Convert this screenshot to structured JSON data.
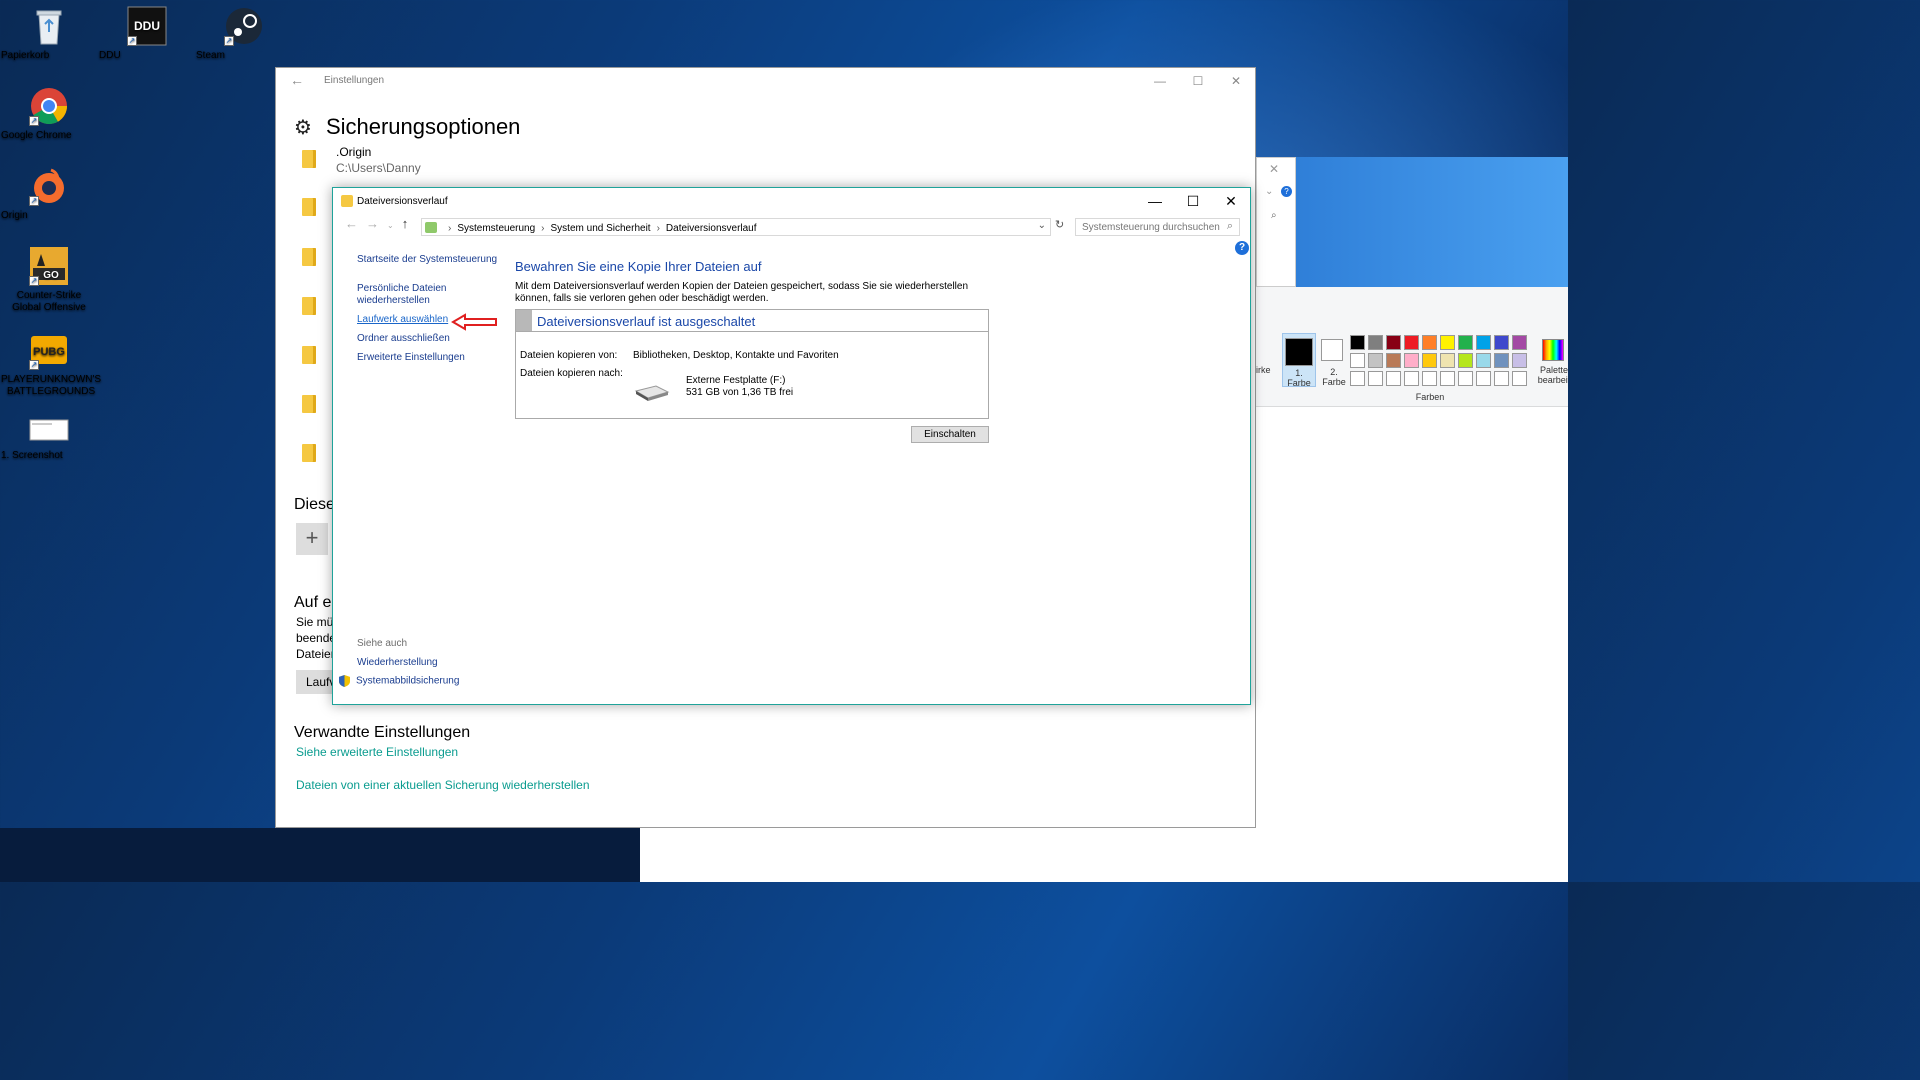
{
  "desktop": {
    "icons": [
      {
        "label": "Papierkorb",
        "icon": "recycle-bin-icon"
      },
      {
        "label": "DDU",
        "icon": "ddu-icon"
      },
      {
        "label": "Steam",
        "icon": "steam-icon"
      },
      {
        "label": "Google Chrome",
        "icon": "chrome-icon"
      },
      {
        "label": "Origin",
        "icon": "origin-icon"
      },
      {
        "label": "Counter-Strike Global Offensive",
        "icon": "csgo-icon"
      },
      {
        "label": "PLAYERUNKNOWN'S BATTLEGROUNDS",
        "icon": "pubg-icon"
      },
      {
        "label": "1. Screenshot",
        "icon": "screenshot-icon"
      }
    ]
  },
  "settings": {
    "window_title": "Einstellungen",
    "page_title": "Sicherungsoptionen",
    "folder_item": {
      "name": ".Origin",
      "path": "C:\\Users\\Danny"
    },
    "section_partial": "Diese",
    "section2_partial": "Auf e",
    "section2_lines": [
      "Sie mü",
      "beende",
      "Dateier"
    ],
    "button_partial": "Laufv",
    "related_title": "Verwandte Einstellungen",
    "link_advanced": "Siehe erweiterte Einstellungen",
    "link_restore": "Dateien von einer aktuellen Sicherung wiederherstellen"
  },
  "paint": {
    "color1_label": "1. Farbe",
    "color2_label": "2. Farbe",
    "strength_partial": "irke",
    "palette_edit": "Palette bearbeit",
    "colors_group": "Farben",
    "swatches_row1": [
      "#000000",
      "#7f7f7f",
      "#880015",
      "#ed1c24",
      "#ff7f27",
      "#fff200",
      "#22b14c",
      "#00a2e8",
      "#3f48cc",
      "#a349a4"
    ],
    "swatches_row2": [
      "#ffffff",
      "#c3c3c3",
      "#b97a57",
      "#ffaec9",
      "#ffc90e",
      "#efe4b0",
      "#b5e61d",
      "#99d9ea",
      "#7092be",
      "#c8bfe7"
    ]
  },
  "dialog": {
    "title": "Dateiversionsverlauf",
    "breadcrumb": [
      "Systemsteuerung",
      "System und Sicherheit",
      "Dateiversionsverlauf"
    ],
    "search_placeholder": "Systemsteuerung durchsuchen",
    "sidebar": {
      "home": "Startseite der Systemsteuerung",
      "restore_personal": "Persönliche Dateien wiederherstellen",
      "choose_drive": "Laufwerk auswählen",
      "exclude_folders": "Ordner ausschließen",
      "advanced": "Erweiterte Einstellungen",
      "see_also": "Siehe auch",
      "recovery": "Wiederherstellung",
      "system_image": "Systemabbildsicherung"
    },
    "heading": "Bewahren Sie eine Kopie Ihrer Dateien auf",
    "description": "Mit dem Dateiversionsverlauf werden Kopien der Dateien gespeichert, sodass Sie sie wiederherstellen können, falls sie verloren gehen oder beschädigt werden.",
    "status": "Dateiversionsverlauf ist ausgeschaltet",
    "copy_from_label": "Dateien kopieren von:",
    "copy_from_value": "Bibliotheken, Desktop, Kontakte und Favoriten",
    "copy_to_label": "Dateien kopieren nach:",
    "drive_name": "Externe Festplatte (F:)",
    "drive_space": "531 GB von 1,36 TB frei",
    "enable_button": "Einschalten"
  }
}
